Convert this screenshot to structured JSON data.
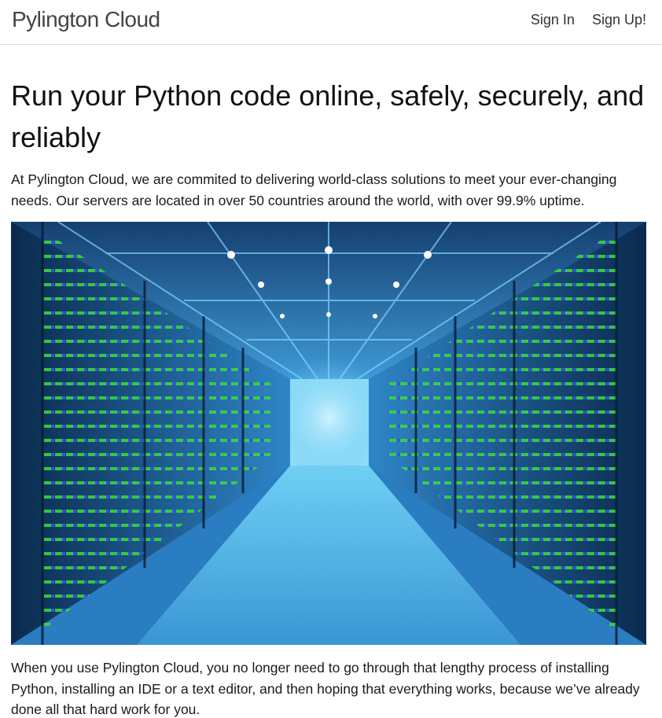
{
  "navbar": {
    "brand": "Pylington Cloud",
    "links": [
      {
        "label": "Sign In"
      },
      {
        "label": "Sign Up!"
      }
    ]
  },
  "main": {
    "heading": "Run your Python code online, safely, securely, and reliably",
    "intro": "At Pylington Cloud, we are commited to delivering world-class solutions to meet your ever-changing needs. Our servers are located in over 50 countries around the world, with over 99.9% uptime.",
    "hero_image": {
      "subject": "data center server room corridor",
      "colors": {
        "primary": "#1e6fb0",
        "accent_green": "#3ddc3a",
        "light": "#9fe3ff"
      }
    },
    "body": "When you use Pylington Cloud, you no longer need to go through that lengthy process of installing Python, installing an IDE or a text editor, and then hoping that everything works, because we’ve already done all that hard work for you."
  }
}
